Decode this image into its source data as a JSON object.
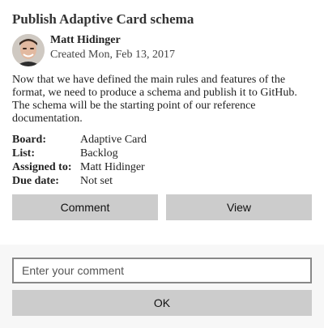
{
  "card": {
    "title": "Publish Adaptive Card schema",
    "author": {
      "name": "Matt Hidinger",
      "created": "Created Mon, Feb 13, 2017"
    },
    "description": "Now that we have defined the main rules and features of the format, we need to produce a schema and publish it to GitHub. The schema will be the starting point of our reference documentation.",
    "facts": [
      {
        "key": "Board:",
        "value": "Adaptive Card"
      },
      {
        "key": "List:",
        "value": "Backlog"
      },
      {
        "key": "Assigned to:",
        "value": "Matt Hidinger"
      },
      {
        "key": "Due date:",
        "value": "Not set"
      }
    ],
    "actions": {
      "comment_label": "Comment",
      "view_label": "View"
    }
  },
  "comment_panel": {
    "input_placeholder": "Enter your comment",
    "input_value": "",
    "ok_label": "OK"
  }
}
